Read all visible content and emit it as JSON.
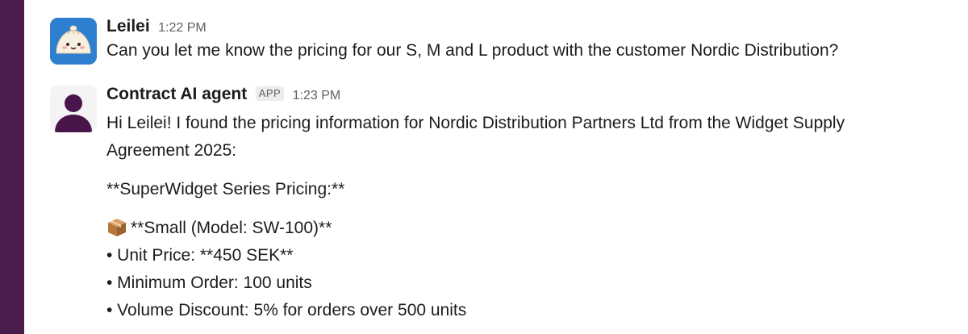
{
  "messages": [
    {
      "sender": "Leilei",
      "time": "1:22 PM",
      "text": "Can you let me know the pricing for our S, M and L product with the customer Nordic Distribution?",
      "avatar_icon": "bao-dumpling-avatar",
      "avatar_color": "#2f7fd1"
    },
    {
      "sender": "Contract AI agent",
      "badge": "APP",
      "time": "1:23 PM",
      "avatar_icon": "person-avatar",
      "avatar_color": "#4a154b",
      "intro_line1": "Hi Leilei! I found the pricing information for Nordic Distribution Partners Ltd from the Widget Supply",
      "intro_line2": "Agreement 2025:",
      "heading": "**SuperWidget Series Pricing:**",
      "product_title": "**Small (Model: SW-100)**",
      "product_icon": "package-emoji",
      "bullets": [
        "• Unit Price: **450 SEK**",
        "• Minimum Order: 100 units",
        "• Volume Discount: 5% for orders over 500 units"
      ]
    }
  ],
  "colors": {
    "sidebar": "#4a1d4c",
    "text": "#1d1c1d",
    "muted": "#616061"
  }
}
